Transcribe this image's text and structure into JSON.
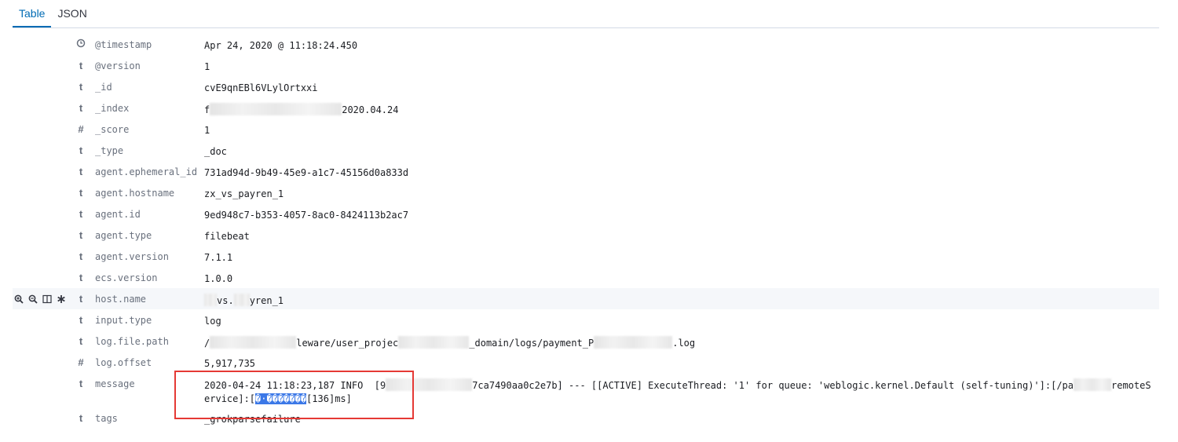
{
  "tabs": [
    {
      "label": "Table",
      "selected": true
    },
    {
      "label": "JSON",
      "selected": false
    }
  ],
  "fields": [
    {
      "type_icon": "clock-icon",
      "name": "@timestamp",
      "value": "Apr 24, 2020 @ 11:18:24.450"
    },
    {
      "type_icon": "t",
      "name": "@version",
      "value": "1"
    },
    {
      "type_icon": "t",
      "name": "_id",
      "value": "cvE9qnEBl6VLylOrtxxi"
    },
    {
      "type_icon": "t",
      "name": "_index",
      "value_prefix": "f",
      "value_suffix": "2020.04.24"
    },
    {
      "type_icon": "#",
      "name": "_score",
      "value": "1"
    },
    {
      "type_icon": "t",
      "name": "_type",
      "value": "_doc"
    },
    {
      "type_icon": "t",
      "name": "agent.ephemeral_id",
      "value": "731ad94d-9b49-45e9-a1c7-45156d0a833d"
    },
    {
      "type_icon": "t",
      "name": "agent.hostname",
      "value": "zx_vs_payren_1"
    },
    {
      "type_icon": "t",
      "name": "agent.id",
      "value": "9ed948c7-b353-4057-8ac0-8424113b2ac7"
    },
    {
      "type_icon": "t",
      "name": "agent.type",
      "value": "filebeat"
    },
    {
      "type_icon": "t",
      "name": "agent.version",
      "value": "7.1.1"
    },
    {
      "type_icon": "t",
      "name": "ecs.version",
      "value": "1.0.0"
    },
    {
      "type_icon": "t",
      "name": "host.name",
      "value_part1": "vs.",
      "value_part2": "yren_1"
    },
    {
      "type_icon": "t",
      "name": "input.type",
      "value": "log"
    },
    {
      "type_icon": "t",
      "name": "log.file.path",
      "value_part1": "/",
      "value_part2": "leware/user_projec",
      "value_part3": "_domain/logs/payment_P",
      "value_part4": ".log"
    },
    {
      "type_icon": "#",
      "name": "log.offset",
      "value": "5,917,735"
    },
    {
      "type_icon": "t",
      "name": "message",
      "value_part1": "2020-04-24 11:18:23,187 INFO  [9",
      "value_part2": "7ca7490aa0c2e7b] --- [[ACTIVE] ExecuteThread: '1' for queue: 'weblogic.kernel.Default (self-tuning)']:[/pa",
      "value_part3": "remoteServ",
      "value_part4": "ice]:[",
      "selected_text": "�·�������",
      "value_part5": "[136]ms]"
    },
    {
      "type_icon": "t",
      "name": "tags",
      "value": "_grokparsefailure"
    }
  ],
  "row_actions": [
    "zoom-in-icon",
    "zoom-out-icon",
    "toggle-column-icon",
    "filter-exists-icon"
  ]
}
